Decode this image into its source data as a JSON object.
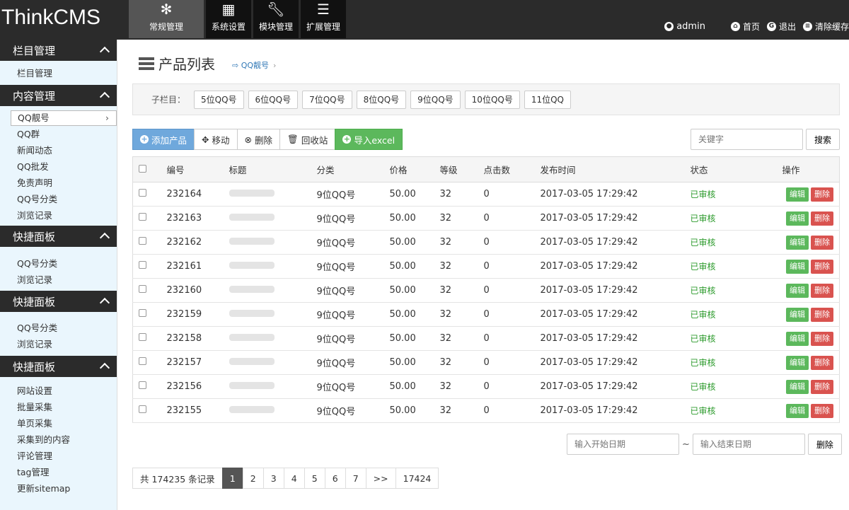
{
  "brand": "ThinkCMS",
  "topnav": [
    {
      "label": "常规管理",
      "icon": "snowflake-icon"
    },
    {
      "label": "系统设置",
      "icon": "grid-icon"
    },
    {
      "label": "模块管理",
      "icon": "wrench-icon"
    },
    {
      "label": "扩展管理",
      "icon": "list-icon"
    }
  ],
  "topright": {
    "user": "admin",
    "home": "首页",
    "logout": "退出",
    "clear_cache": "清除缓存"
  },
  "sidebar": {
    "sections": [
      {
        "title": "栏目管理",
        "items": [
          "栏目管理"
        ]
      },
      {
        "title": "内容管理",
        "items": [
          "QQ靓号",
          "QQ群",
          "新闻动态",
          "QQ批发",
          "免责声明",
          "QQ号分类",
          "浏览记录"
        ]
      },
      {
        "title": "快捷面板",
        "items": [
          "QQ号分类",
          "浏览记录"
        ]
      },
      {
        "title": "快捷面板",
        "items": [
          "QQ号分类",
          "浏览记录"
        ]
      },
      {
        "title": "快捷面板",
        "items": [
          "网站设置",
          "批量采集",
          "单页采集",
          "采集到的内容",
          "评论管理",
          "tag管理",
          "更新sitemap"
        ]
      }
    ]
  },
  "page": {
    "title": "产品列表",
    "breadcrumb": "QQ靓号"
  },
  "subcat": {
    "label": "子栏目：",
    "chips": [
      "5位QQ号",
      "6位QQ号",
      "7位QQ号",
      "8位QQ号",
      "9位QQ号",
      "10位QQ号",
      "11位QQ"
    ]
  },
  "toolbar": {
    "add": "添加产品",
    "move": "移动",
    "delete": "删除",
    "recycle": "回收站",
    "import": "导入excel"
  },
  "search": {
    "placeholder": "关键字",
    "button": "搜索"
  },
  "table": {
    "headers": [
      "编号",
      "标题",
      "分类",
      "价格",
      "等级",
      "点击数",
      "发布时间",
      "状态",
      "操作"
    ],
    "edit_label": "编辑",
    "delete_label": "删除",
    "rows": [
      {
        "id": "232164",
        "category": "9位QQ号",
        "price": "50.00",
        "level": "32",
        "clicks": "0",
        "time": "2017-03-05 17:29:42",
        "status": "已审核"
      },
      {
        "id": "232163",
        "category": "9位QQ号",
        "price": "50.00",
        "level": "32",
        "clicks": "0",
        "time": "2017-03-05 17:29:42",
        "status": "已审核"
      },
      {
        "id": "232162",
        "category": "9位QQ号",
        "price": "50.00",
        "level": "32",
        "clicks": "0",
        "time": "2017-03-05 17:29:42",
        "status": "已审核"
      },
      {
        "id": "232161",
        "category": "9位QQ号",
        "price": "50.00",
        "level": "32",
        "clicks": "0",
        "time": "2017-03-05 17:29:42",
        "status": "已审核"
      },
      {
        "id": "232160",
        "category": "9位QQ号",
        "price": "50.00",
        "level": "32",
        "clicks": "0",
        "time": "2017-03-05 17:29:42",
        "status": "已审核"
      },
      {
        "id": "232159",
        "category": "9位QQ号",
        "price": "50.00",
        "level": "32",
        "clicks": "0",
        "time": "2017-03-05 17:29:42",
        "status": "已审核"
      },
      {
        "id": "232158",
        "category": "9位QQ号",
        "price": "50.00",
        "level": "32",
        "clicks": "0",
        "time": "2017-03-05 17:29:42",
        "status": "已审核"
      },
      {
        "id": "232157",
        "category": "9位QQ号",
        "price": "50.00",
        "level": "32",
        "clicks": "0",
        "time": "2017-03-05 17:29:42",
        "status": "已审核"
      },
      {
        "id": "232156",
        "category": "9位QQ号",
        "price": "50.00",
        "level": "32",
        "clicks": "0",
        "time": "2017-03-05 17:29:42",
        "status": "已审核"
      },
      {
        "id": "232155",
        "category": "9位QQ号",
        "price": "50.00",
        "level": "32",
        "clicks": "0",
        "time": "2017-03-05 17:29:42",
        "status": "已审核"
      }
    ]
  },
  "daterange": {
    "start_placeholder": "输入开始日期",
    "separator": "~",
    "end_placeholder": "输入结束日期",
    "delete": "删除"
  },
  "pager": {
    "total": "共 174235 条记录",
    "pages": [
      "1",
      "2",
      "3",
      "4",
      "5",
      "6",
      "7"
    ],
    "next": ">>",
    "last": "17424",
    "current": "1"
  }
}
